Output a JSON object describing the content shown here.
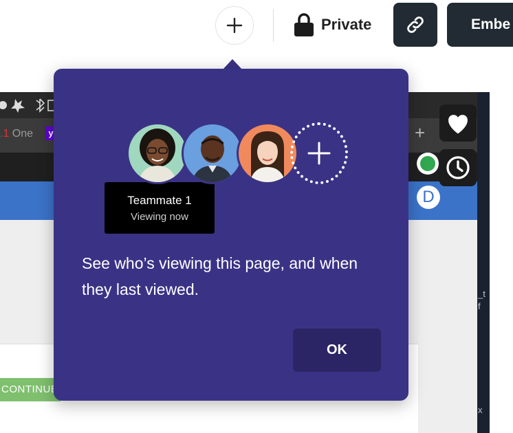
{
  "toolbar": {
    "add_icon": "plus-icon",
    "privacy_icon": "lock-icon",
    "privacy_label": "Private",
    "link_icon": "link-icon",
    "embed_label": "Embe"
  },
  "side_buttons": {
    "favorite_icon": "heart-icon",
    "history_icon": "clock-icon"
  },
  "embedded_screenshot": {
    "tab_number": ".1",
    "tab_text": "One",
    "yahoo_badge": "y",
    "new_tab_symbol": "+",
    "profile_letter": "D",
    "continue_label": "CONTINUE",
    "right_edge_text_1": "_t\nf",
    "right_edge_text_2": "x"
  },
  "popover": {
    "tooltip": {
      "name": "Teammate 1",
      "status": "Viewing now"
    },
    "message": "See who’s viewing this page, and when they last viewed.",
    "ok_label": "OK",
    "colors": {
      "background": "#3a3385",
      "button": "#2b2566",
      "avatar_1": "#9fd7bf",
      "avatar_2": "#6a9fe0",
      "avatar_3": "#f08a5d"
    }
  }
}
